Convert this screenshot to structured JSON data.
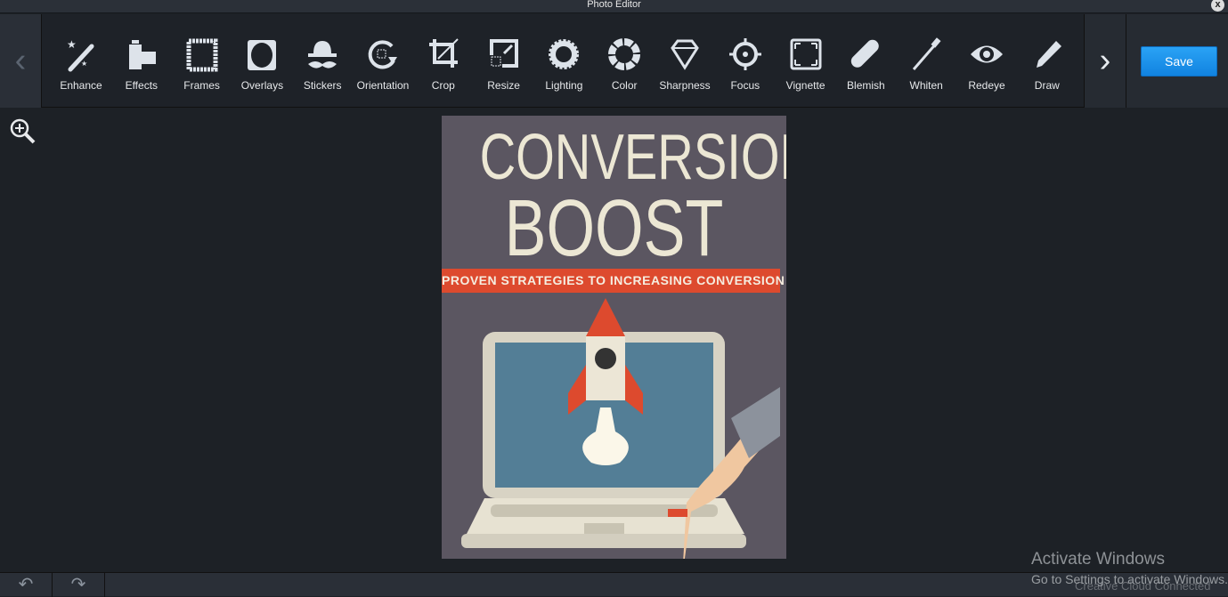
{
  "window": {
    "title": "Photo Editor",
    "close": "x"
  },
  "toolbar": {
    "tools": [
      {
        "label": "Enhance",
        "icon": "magic-wand-icon"
      },
      {
        "label": "Effects",
        "icon": "film-icon"
      },
      {
        "label": "Frames",
        "icon": "frame-icon"
      },
      {
        "label": "Overlays",
        "icon": "overlay-icon"
      },
      {
        "label": "Stickers",
        "icon": "mustache-hat-icon"
      },
      {
        "label": "Orientation",
        "icon": "rotate-icon"
      },
      {
        "label": "Crop",
        "icon": "crop-icon"
      },
      {
        "label": "Resize",
        "icon": "resize-icon"
      },
      {
        "label": "Lighting",
        "icon": "sun-icon"
      },
      {
        "label": "Color",
        "icon": "color-wheel-icon"
      },
      {
        "label": "Sharpness",
        "icon": "diamond-icon"
      },
      {
        "label": "Focus",
        "icon": "crosshair-icon"
      },
      {
        "label": "Vignette",
        "icon": "vignette-icon"
      },
      {
        "label": "Blemish",
        "icon": "bandage-icon"
      },
      {
        "label": "Whiten",
        "icon": "toothbrush-icon"
      },
      {
        "label": "Redeye",
        "icon": "eye-icon"
      },
      {
        "label": "Draw",
        "icon": "pencil-icon"
      }
    ],
    "prev": "‹",
    "next": "›",
    "save_label": "Save"
  },
  "image": {
    "title1": "CONVERSION",
    "title2": "BOOST",
    "subtitle": "PROVEN STRATEGIES TO INCREASING CONVERSION RATES!"
  },
  "bottom": {
    "undo": "↶",
    "redo": "↷"
  },
  "watermark": {
    "line1": "Activate Windows",
    "line2": "Go to Settings to activate Windows.",
    "status": "Creative Cloud Connected"
  }
}
